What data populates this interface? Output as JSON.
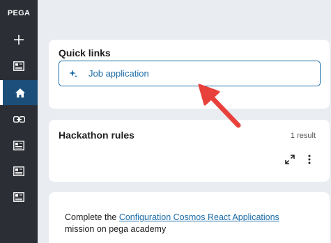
{
  "sidebar": {
    "brand": "PEGA",
    "items": [
      {
        "icon": "plus-icon",
        "active": false
      },
      {
        "icon": "document-icon",
        "active": false
      },
      {
        "icon": "home-icon",
        "active": true
      },
      {
        "icon": "link-icon",
        "active": false
      },
      {
        "icon": "document-icon",
        "active": false
      },
      {
        "icon": "document-icon",
        "active": false
      },
      {
        "icon": "document-icon",
        "active": false
      }
    ]
  },
  "quick_links": {
    "title": "Quick links",
    "items": [
      {
        "label": "Job application",
        "icon": "sparkle-icon"
      }
    ]
  },
  "hackathon_rules": {
    "title": "Hackathon rules",
    "result_count": "1 result",
    "icons": [
      "expand-icon",
      "more-vertical-icon"
    ]
  },
  "mission_card": {
    "text_before": "Complete the ",
    "link_text": " Configuration Cosmos React Applications",
    "text_after": "mission on pega academy"
  },
  "colors": {
    "sidebar_bg": "#2b2e35",
    "active_item_bg": "#1b4f7a",
    "accent": "#1b6ca8",
    "annotation_arrow": "#e8413b"
  }
}
